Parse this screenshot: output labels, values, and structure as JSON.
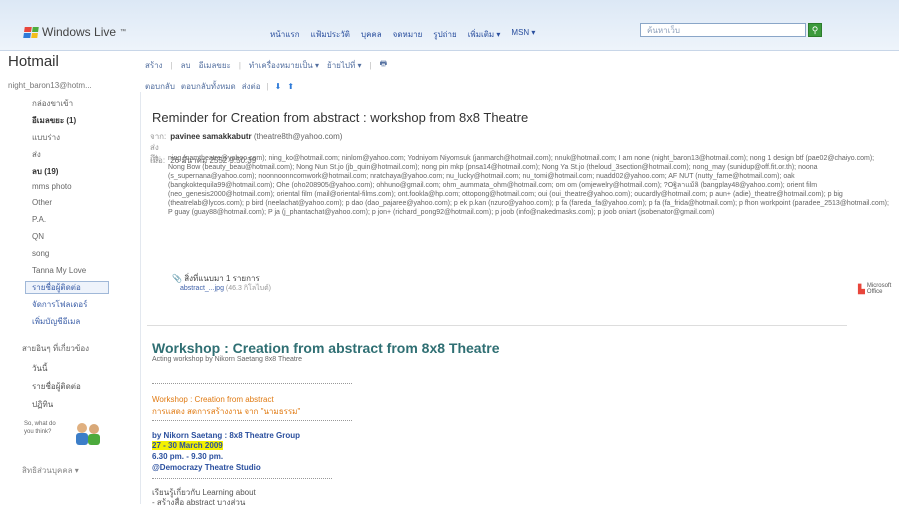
{
  "header": {
    "logo": "Windows Live",
    "logo_tm": "™",
    "nav": [
      "หน้าแรก",
      "แฟ้มประวัติ",
      "บุคคล",
      "จดหมาย",
      "รูปถ่าย",
      "เพิ่มเติม ▾",
      "MSN ▾"
    ],
    "search_placeholder": "ค้นหาเว็บ",
    "search_icon": "search-icon",
    "colors": {
      "flag_red": "#e8463b",
      "flag_green": "#4dac3c",
      "flag_blue": "#2f7bd8",
      "flag_yellow": "#f3be1c"
    }
  },
  "app": {
    "title": "Hotmail",
    "account": "night_baron13@hotm..."
  },
  "toolbar": {
    "items": [
      "สร้าง",
      "ลบ",
      "อีเมลขยะ",
      "ทำเครื่องหมายเป็น ▾",
      "ย้ายไปที่ ▾",
      "🖶"
    ]
  },
  "subbar": {
    "items": [
      "ตอบกลับ",
      "ตอบกลับทั้งหมด",
      "ส่งต่อ",
      "⬇",
      "⬆"
    ]
  },
  "sidebar": {
    "folders": [
      "กล่องขาเข้า",
      "อีเมลขยะ (1)",
      "แบบร่าง",
      "ส่ง",
      "ลบ (19)",
      "mms photo",
      "Other",
      "P.A.",
      "QN",
      "song",
      "Tanna My Love",
      "รายชื่อผู้ติดต่อ",
      "จัดการโฟลเดอร์",
      "เพิ่มบัญชีอีเมล"
    ],
    "section": "สายอินๆ ที่เกี่ยวข้อง",
    "sub": [
      "วันนี้",
      "รายชื่อผู้ติดต่อ",
      "ปฏิทิน"
    ],
    "promo": "So, what do you think?",
    "footer": "สิทธิส่วนบุคคล ▾"
  },
  "message": {
    "subject": "Reminder for Creation from abstract : workshop from 8x8 Theatre",
    "from_label": "จาก:",
    "from": "pavinee samakkabutr",
    "from_email": "(theatre8th@yahoo.com)",
    "date_label": "ส่งเมื่อ:",
    "date": "26 มีนาคม 2552 9:50:39",
    "to_label": "ถึง:",
    "recipients": "ning (namtheatre@yahoo.com); ning_ko@hotmail.com; ninlom@yahoo.com; Yodniyom Niyomsuk (janmarch@hotmail.com); nnuk@hotmail.com; I am none (night_baron13@hotmail.com); nong 1 design btf (pae02@chaiyo.com); Nong Bow (beauty_beau@hotmail.com); Nong Nun St.jo (jb_quin@hotmail.com); nong pin mkp (pnsa14@hotmail.com); Nong Ya St.jo (theloud_3section@hotmail.com); nong_may (sunidup@off.fit.or.th); noona (s_supernana@yahoo.com); noonnoonncomwork@hotmail.com; nratchaya@yahoo.com; nu_lucky@hotmail.com; nu_tomi@hotmail.com; nuadd02@yahoo.com; AF NUT (nutty_fame@hotmail.com); oak (bangkoktequila99@hotmail.com); Ohe (oho208905@yahoo.com); ohhuno@gmail.com; ohm_aummata_ohm@hotmail.com; om om (omjewelry@hotmail.com); ?Oฐิลาแม้ลิ (bangplay48@yahoo.com); orient film (neo_genesis2000@hotmail.com); oriental film (mail@oriental-films.com); ont.fookla@hp.com; ottopong@hotmail.com; oui (oui_theatre@yahoo.com); oucardly@hotmail.com; p aun+ (adie)_theatre@hotmail.com); p big (theatrelab@lycos.com); p bird (neelachat@yahoo.com); p dao (dao_pajaree@yahoo.com); p ek p.kan (nzuro@yahoo.com); p fa (fareda_fa@yahoo.com); p fa (fa_frida@hotmail.com); p fhon workpoint (paradee_2513@hotmail.com); P guay (guay88@hotmail.com); P ja (j_phantachat@yahoo.com); p jon+ (richard_pong92@hotmail.com); p joob (info@nakedmasks.com); p joob oniart (jsobenator@gmail.com)",
    "attach_label": "สิ่งที่แนบมา 1 รายการ",
    "attach_file": "abstract_...jpg",
    "attach_size": "(46.3 กิโลไบต์)",
    "office": "Microsoft Office"
  },
  "body": {
    "title": "Workshop : Creation from abstract from 8x8 Theatre",
    "subtitle": "Acting workshop by Nikorn Saetang 8x8 Theatre",
    "orange1": "Workshop : Creation from abstract",
    "orange2": "การแสดง สดการสร้างงาน จาก \"นามธรรม\"",
    "by": "by Nikorn Saetang : 8x8 Theatre Group",
    "dates": "27 - 30 March 2009",
    "time": "6.30 pm. - 9.30 pm.",
    "venue": "@Democrazy Theatre Studio",
    "learn1": "เรียนรู้เกี่ยวกับ Learning about",
    "learn2": "- สร้างสื่อ abstract บางส่วน"
  }
}
